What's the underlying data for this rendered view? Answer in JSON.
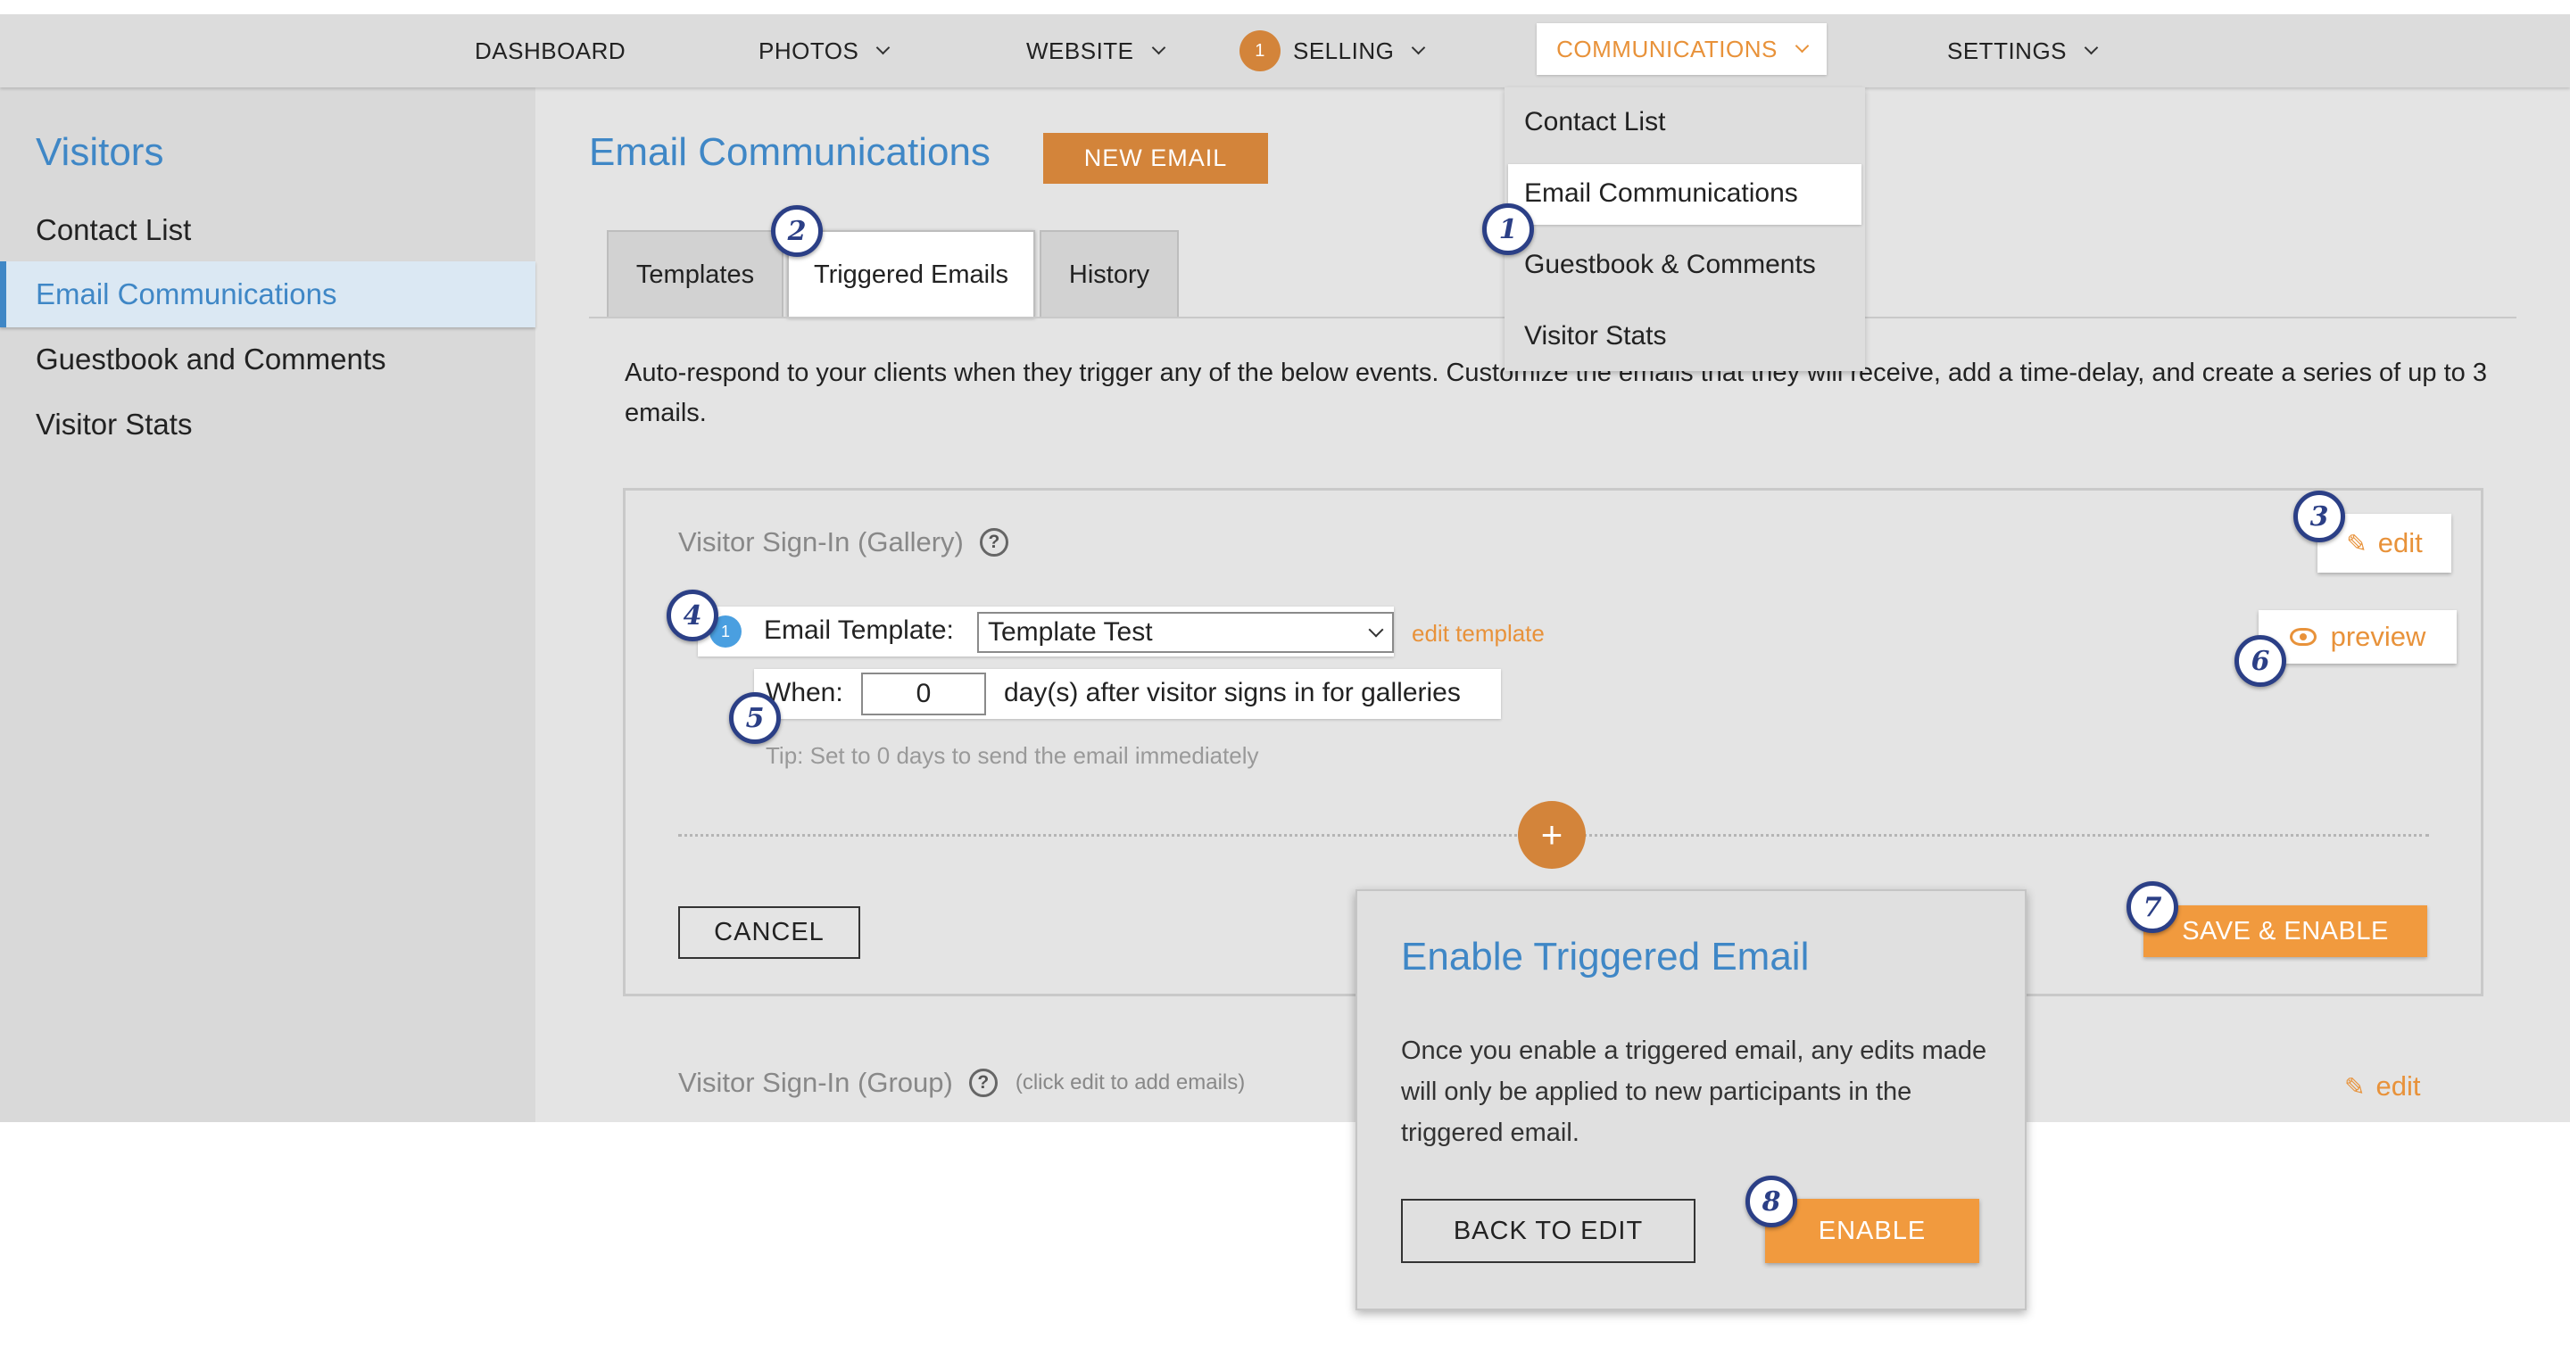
{
  "nav": {
    "dashboard": "DASHBOARD",
    "photos": "PHOTOS",
    "website": "WEBSITE",
    "selling_badge": "1",
    "selling": "SELLING",
    "communications": "COMMUNICATIONS",
    "settings": "SETTINGS"
  },
  "dropdown": {
    "items": [
      "Contact List",
      "Email Communications",
      "Guestbook & Comments",
      "Visitor Stats"
    ]
  },
  "sidebar": {
    "title": "Visitors",
    "items": [
      "Contact List",
      "Email Communications",
      "Guestbook and Comments",
      "Visitor Stats"
    ]
  },
  "page": {
    "title": "Email Communications",
    "new_email": "NEW EMAIL"
  },
  "tabs": [
    "Templates",
    "Triggered Emails",
    "History"
  ],
  "description": "Auto-respond to your clients when they trigger any of the below events. Customize the emails that they will receive, add a time-delay, and create a series of up to 3 emails.",
  "panel": {
    "title": "Visitor Sign-In (Gallery)",
    "help_icon": "?",
    "edit": "edit",
    "preview": "preview",
    "step_number": "1",
    "template_label": "Email Template:",
    "template_value": "Template Test",
    "edit_template": "edit template",
    "when_label": "When:",
    "when_value": "0",
    "when_after": "day(s) after visitor signs in for galleries",
    "tip": "Tip: Set to 0 days to send the email immediately",
    "plus": "+",
    "cancel": "CANCEL",
    "save_enable": "SAVE & ENABLE"
  },
  "panel2": {
    "title": "Visitor Sign-In (Group)",
    "help_icon": "?",
    "hint": "(click edit to add emails)",
    "edit": "edit"
  },
  "modal": {
    "title": "Enable Triggered Email",
    "body": "Once you enable a triggered email, any edits made will only be applied to new participants in the triggered email.",
    "back": "BACK TO EDIT",
    "enable": "ENABLE"
  },
  "callouts": [
    "1",
    "2",
    "3",
    "4",
    "5",
    "6",
    "7",
    "8"
  ],
  "colors": {
    "accent_blue": "#3f87c6",
    "accent_orange": "#e8923a",
    "callout_navy": "#2b3f86"
  }
}
